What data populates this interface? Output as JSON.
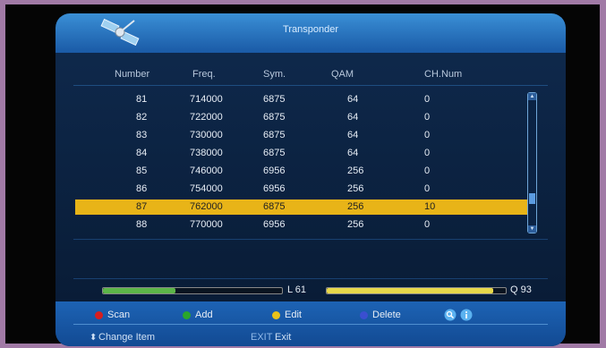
{
  "header": {
    "title": "Transponder"
  },
  "columns": [
    "Number",
    "Freq.",
    "Sym.",
    "QAM",
    "CH.Num"
  ],
  "rows": [
    {
      "number": "81",
      "freq": "714000",
      "sym": "6875",
      "qam": "64",
      "chnum": "0"
    },
    {
      "number": "82",
      "freq": "722000",
      "sym": "6875",
      "qam": "64",
      "chnum": "0"
    },
    {
      "number": "83",
      "freq": "730000",
      "sym": "6875",
      "qam": "64",
      "chnum": "0"
    },
    {
      "number": "84",
      "freq": "738000",
      "sym": "6875",
      "qam": "64",
      "chnum": "0"
    },
    {
      "number": "85",
      "freq": "746000",
      "sym": "6956",
      "qam": "256",
      "chnum": "0"
    },
    {
      "number": "86",
      "freq": "754000",
      "sym": "6956",
      "qam": "256",
      "chnum": "0"
    },
    {
      "number": "87",
      "freq": "762000",
      "sym": "6875",
      "qam": "256",
      "chnum": "10"
    },
    {
      "number": "88",
      "freq": "770000",
      "sym": "6956",
      "qam": "256",
      "chnum": "0"
    }
  ],
  "selected_row": 6,
  "signal": {
    "level_label": "L 61",
    "level_fraction": 0.61,
    "level_color": "#5cb548",
    "quality_label": "Q 93",
    "quality_fraction": 0.93,
    "quality_color": "#e8d84a"
  },
  "footer": {
    "buttons": [
      {
        "label": "Scan",
        "color": "#d81e1e"
      },
      {
        "label": "Add",
        "color": "#2aa62a"
      },
      {
        "label": "Edit",
        "color": "#e8c21a"
      },
      {
        "label": "Delete",
        "color": "#3a4fd0"
      }
    ],
    "icons": [
      "search-icon",
      "info-icon"
    ],
    "nav_change": "Change Item",
    "nav_exit_key": "EXIT",
    "nav_exit": "Exit"
  }
}
